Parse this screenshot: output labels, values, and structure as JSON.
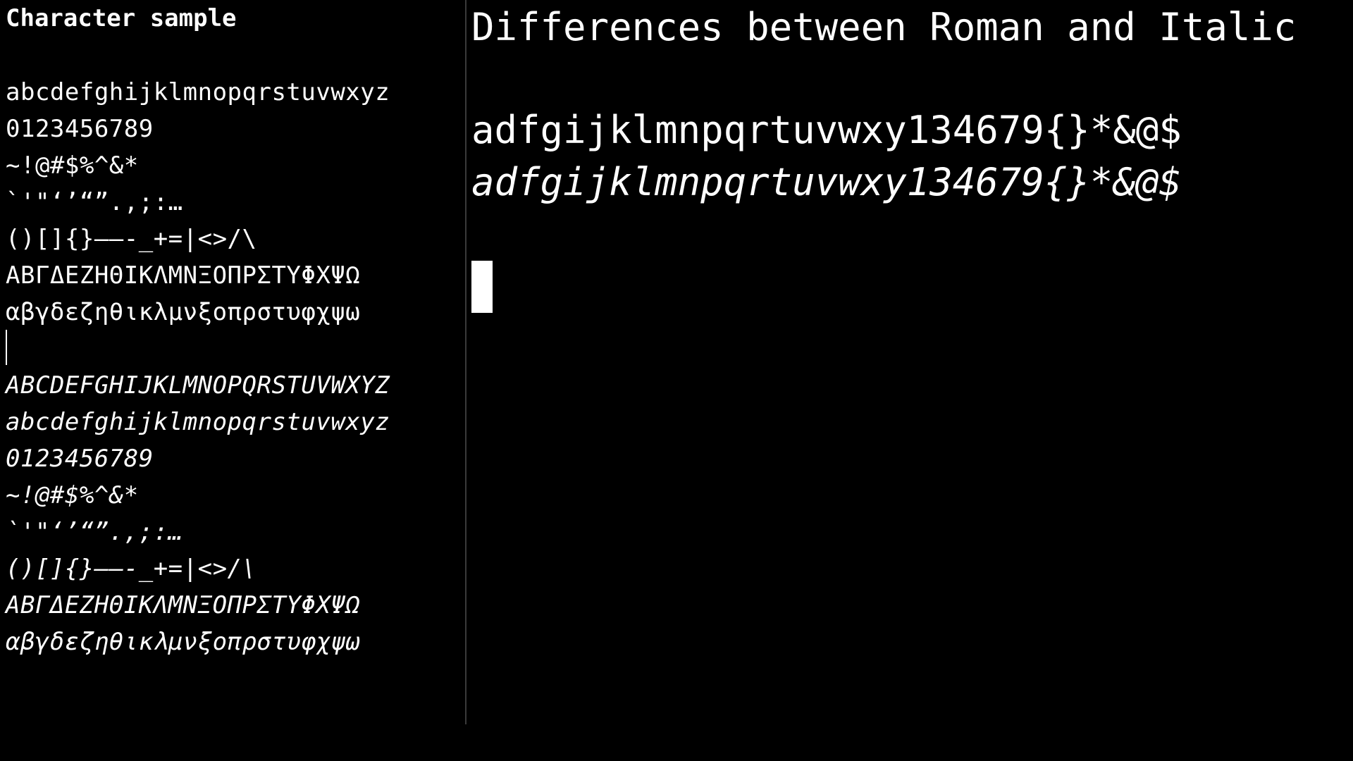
{
  "left_pane": {
    "title": "Character sample",
    "roman_lines": [
      "abcdefghijklmnopqrstuvwxyz",
      "0123456789",
      "~!@#$%^&*",
      "`'\"‘’“”.,;:…",
      "()[]{}—–-_+=|<>/\\",
      "ΑΒΓΔΕΖΗΘΙΚΛΜΝΞΟΠΡΣΤΥΦΧΨΩ",
      "αβγδεζηθικλμνξοπρστυφχψω"
    ],
    "italic_lines": [
      "ABCDEFGHIJKLMNOPQRSTUVWXYZ",
      "abcdefghijklmnopqrstuvwxyz",
      "0123456789",
      "~!@#$%^&*",
      "`'\"‘’“”.,;:…",
      "()[]{}—–-_+=|<>/\\",
      "ΑΒΓΔΕΖΗΘΙΚΛΜΝΞΟΠΡΣΤΥΦΧΨΩ",
      "αβγδεζηθικλμνξοπρστυφχψω"
    ]
  },
  "right_pane": {
    "title": "Differences between Roman and Italic",
    "roman_line": "adfgijklmnpqrtuvwxy134679{}*&@$",
    "italic_line": "adfgijklmnpqrtuvwxy134679{}*&@$"
  },
  "colors": {
    "background": "#000000",
    "text": "#ffffff",
    "divider": "#3a3a3a"
  }
}
